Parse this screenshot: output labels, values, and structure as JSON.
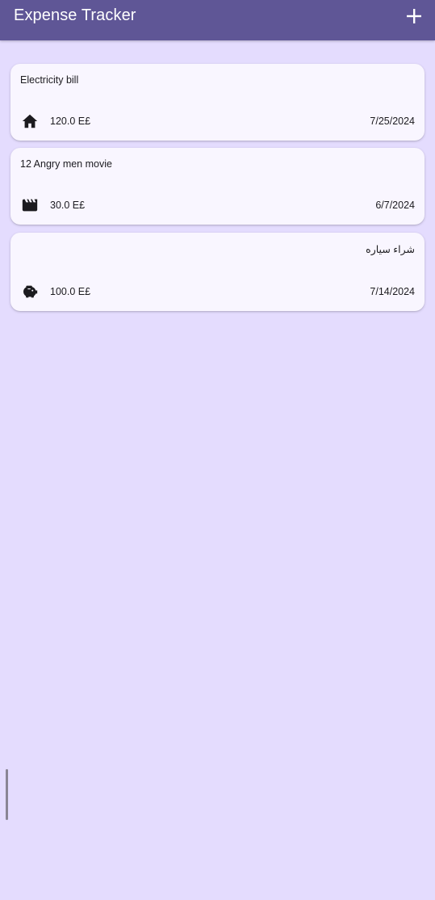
{
  "app_bar": {
    "title": "Expense Tracker",
    "add_icon": "plus-icon",
    "background": "#5f5696"
  },
  "expenses": [
    {
      "title": "Electricity bill",
      "category_icon": "home-icon",
      "amount": "120.0 E£",
      "date": "7/25/2024"
    },
    {
      "title": "12 Angry men movie",
      "category_icon": "movie-clapperboard-icon",
      "amount": "30.0 E£",
      "date": "6/7/2024"
    },
    {
      "title": "شراء سياره",
      "category_icon": "piggy-bank-icon",
      "amount": "100.0 E£",
      "date": "7/14/2024"
    }
  ],
  "colors": {
    "page_background": "#e4dcfe",
    "card_background": "#f9f6ff"
  }
}
